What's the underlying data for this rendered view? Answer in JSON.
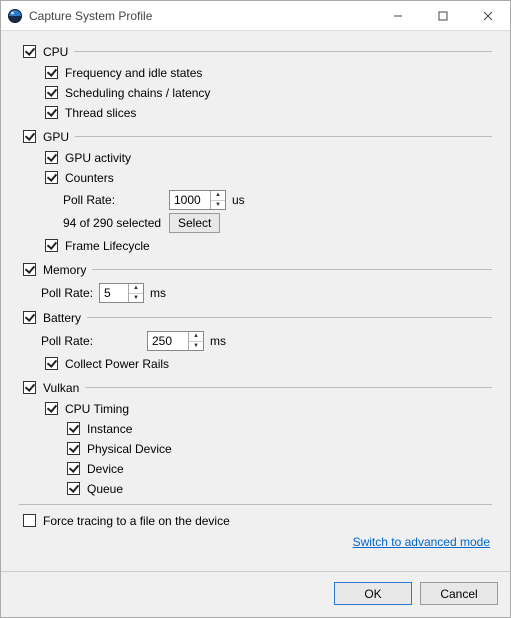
{
  "window": {
    "title": "Capture System Profile"
  },
  "cpu": {
    "label": "CPU",
    "checked": true,
    "freq": {
      "label": "Frequency and idle states",
      "checked": true
    },
    "sched": {
      "label": "Scheduling chains / latency",
      "checked": true
    },
    "slices": {
      "label": "Thread slices",
      "checked": true
    }
  },
  "gpu": {
    "label": "GPU",
    "checked": true,
    "activity": {
      "label": "GPU activity",
      "checked": true
    },
    "counters": {
      "label": "Counters",
      "checked": true,
      "poll_label": "Poll Rate:",
      "poll_value": "1000",
      "poll_unit": "us",
      "selected_text": "94 of 290 selected",
      "select_btn": "Select"
    },
    "frame": {
      "label": "Frame Lifecycle",
      "checked": true
    }
  },
  "memory": {
    "label": "Memory",
    "checked": true,
    "poll_label": "Poll Rate:",
    "poll_value": "5",
    "poll_unit": "ms"
  },
  "battery": {
    "label": "Battery",
    "checked": true,
    "poll_label": "Poll Rate:",
    "poll_value": "250",
    "poll_unit": "ms",
    "rails": {
      "label": "Collect Power Rails",
      "checked": true
    }
  },
  "vulkan": {
    "label": "Vulkan",
    "checked": true,
    "cputiming": {
      "label": "CPU Timing",
      "checked": true,
      "instance": {
        "label": "Instance",
        "checked": true
      },
      "physdev": {
        "label": "Physical Device",
        "checked": true
      },
      "device": {
        "label": "Device",
        "checked": true
      },
      "queue": {
        "label": "Queue",
        "checked": true
      }
    }
  },
  "force_trace": {
    "label": "Force tracing to a file on the device",
    "checked": false
  },
  "advanced_link": "Switch to advanced mode",
  "buttons": {
    "ok": "OK",
    "cancel": "Cancel"
  }
}
